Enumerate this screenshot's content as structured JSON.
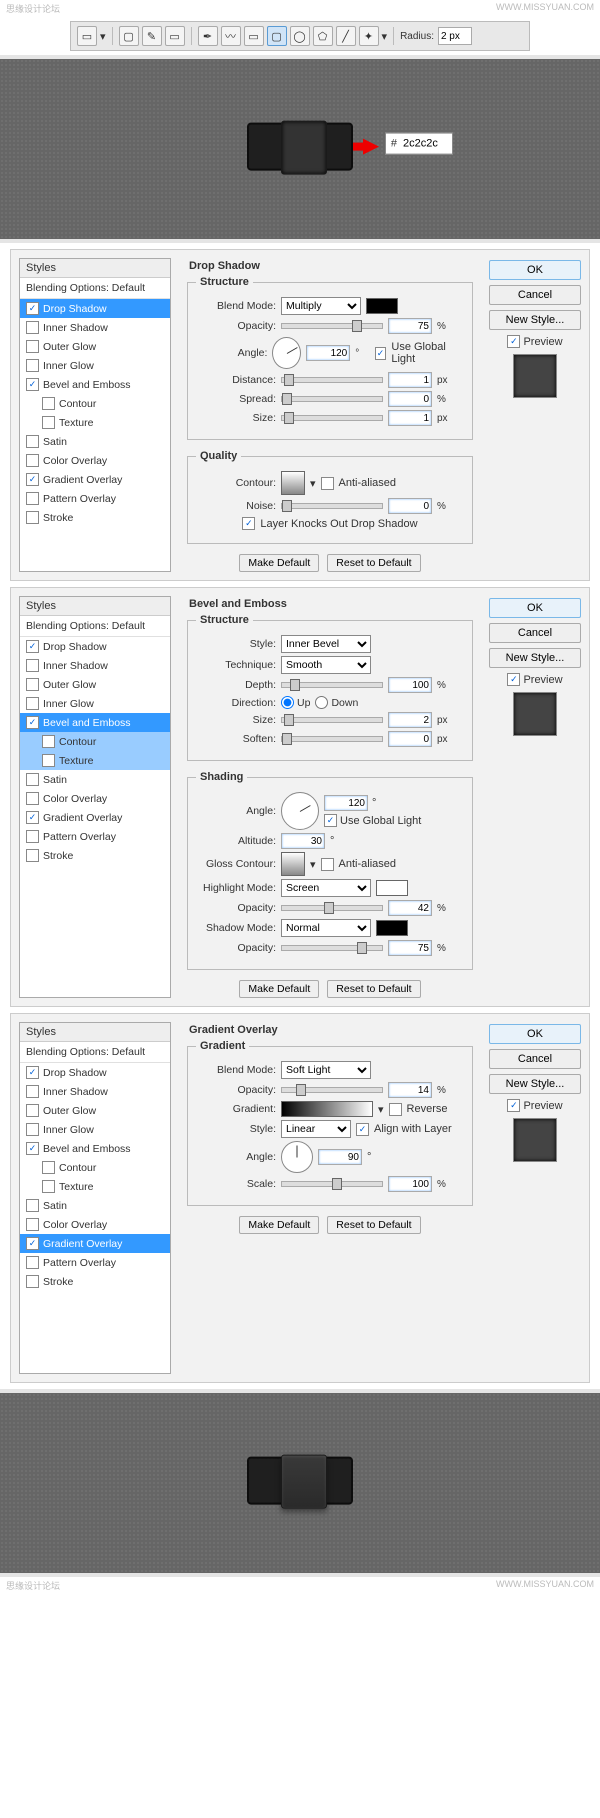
{
  "watermark": {
    "left": "思缘设计论坛",
    "right": "WWW.MISSYUAN.COM"
  },
  "toolbar": {
    "radius_label": "Radius:",
    "radius_value": "2 px"
  },
  "hex": {
    "hash": "#",
    "value": "2c2c2c"
  },
  "styles": {
    "header": "Styles",
    "subheader": "Blending Options: Default",
    "items": [
      "Drop Shadow",
      "Inner Shadow",
      "Outer Glow",
      "Inner Glow",
      "Bevel and Emboss",
      "Contour",
      "Texture",
      "Satin",
      "Color Overlay",
      "Gradient Overlay",
      "Pattern Overlay",
      "Stroke"
    ]
  },
  "buttons": {
    "ok": "OK",
    "cancel": "Cancel",
    "new_style": "New Style...",
    "preview": "Preview",
    "make_default": "Make Default",
    "reset_default": "Reset to Default"
  },
  "panel1": {
    "title": "Drop Shadow",
    "group1": "Structure",
    "blend_mode_label": "Blend Mode:",
    "blend_mode_value": "Multiply",
    "opacity_label": "Opacity:",
    "opacity_value": "75",
    "angle_label": "Angle:",
    "angle_value": "120",
    "deg": "°",
    "use_global": "Use Global Light",
    "distance_label": "Distance:",
    "distance_value": "1",
    "spread_label": "Spread:",
    "spread_value": "0",
    "size_label": "Size:",
    "size_value": "1",
    "group2": "Quality",
    "contour_label": "Contour:",
    "anti_aliased": "Anti-aliased",
    "noise_label": "Noise:",
    "noise_value": "0",
    "knockout": "Layer Knocks Out Drop Shadow",
    "px": "px",
    "pct": "%"
  },
  "panel2": {
    "title": "Bevel and Emboss",
    "group1": "Structure",
    "style_label": "Style:",
    "style_value": "Inner Bevel",
    "technique_label": "Technique:",
    "technique_value": "Smooth",
    "depth_label": "Depth:",
    "depth_value": "100",
    "direction_label": "Direction:",
    "dir_up": "Up",
    "dir_down": "Down",
    "size_label": "Size:",
    "size_value": "2",
    "soften_label": "Soften:",
    "soften_value": "0",
    "group2": "Shading",
    "angle_label": "Angle:",
    "angle_value": "120",
    "deg": "°",
    "use_global": "Use Global Light",
    "altitude_label": "Altitude:",
    "altitude_value": "30",
    "gloss_label": "Gloss Contour:",
    "anti_aliased": "Anti-aliased",
    "highlight_label": "Highlight Mode:",
    "highlight_value": "Screen",
    "opacity_label": "Opacity:",
    "hl_opacity": "42",
    "shadow_label": "Shadow Mode:",
    "shadow_value": "Normal",
    "sh_opacity": "75",
    "px": "px",
    "pct": "%"
  },
  "panel3": {
    "title": "Gradient Overlay",
    "group1": "Gradient",
    "blend_mode_label": "Blend Mode:",
    "blend_mode_value": "Soft Light",
    "opacity_label": "Opacity:",
    "opacity_value": "14",
    "gradient_label": "Gradient:",
    "reverse": "Reverse",
    "style_label": "Style:",
    "style_value": "Linear",
    "align": "Align with Layer",
    "angle_label": "Angle:",
    "angle_value": "90",
    "deg": "°",
    "scale_label": "Scale:",
    "scale_value": "100",
    "pct": "%"
  }
}
